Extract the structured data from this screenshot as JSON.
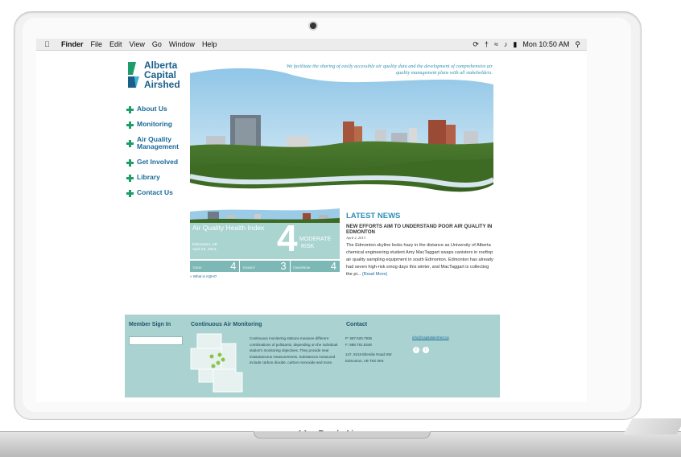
{
  "device": {
    "brand": "MacBook Air"
  },
  "menubar": {
    "items": [
      "Finder",
      "File",
      "Edit",
      "View",
      "Go",
      "Window",
      "Help"
    ],
    "clock": "Mon 10:50 AM"
  },
  "site": {
    "logo_lines": [
      "Alberta",
      "Capital",
      "Airshed"
    ],
    "tagline": "We facilitate the sharing of easily accessible air quality data and the development of comprehensive air quality management plans with all stakeholders.",
    "nav": [
      "About Us",
      "Monitoring",
      "Air Quality Management",
      "Get Involved",
      "Library",
      "Contact Us"
    ],
    "aqhi": {
      "title": "Air Quality Health Index",
      "location": "Edmonton, AB",
      "date": "April 23, 2013",
      "value": "4",
      "risk_line1": "MODERATE",
      "risk_line2": "RISK",
      "forecast": [
        {
          "label": "TODAY",
          "value": "4"
        },
        {
          "label": "TONIGHT",
          "value": "3"
        },
        {
          "label": "TOMORROW",
          "value": "4"
        }
      ],
      "link": "» What is AQHI?"
    },
    "news": {
      "heading": "LATEST NEWS",
      "title": "NEW EFFORTS AIM TO UNDERSTAND POOR AIR QUALITY IN EDMONTON",
      "date": "April 2, 2013",
      "body": "The Edmonton skyline looks hazy in the distance as University of Alberta chemical engineering student Amy MacTaggart swaps canisters in rooftop air quality sampling equipment in south Edmonton. Edmonton has already had seven high-risk smog days this winter, and MacTaggart is collecting the pi...",
      "read_more": "(Read More)"
    },
    "footer": {
      "signin_title": "Member Sign In",
      "monitoring_title": "Continuous Air Monitoring",
      "monitoring_text": "Continuous monitoring stations measure different combinations of pollutants, depending on the individual station's monitoring objectives. They provide near instantaneous measurements. Substances measured include carbon dioxide, carbon monoxide and more.",
      "contact_title": "Contact",
      "phone": "P: 587.520.7935",
      "fax": "F: 888.791.8348",
      "address1": "147, 9218 Ellerslie Road SW",
      "address2": "Edmonton, AB T6X 0K6",
      "email": "info@capitalairshed.ca"
    }
  },
  "colors": {
    "accent": "#2f8fb5",
    "green": "#1e9c6a",
    "aqhi_bg": "#a9d4d0"
  }
}
